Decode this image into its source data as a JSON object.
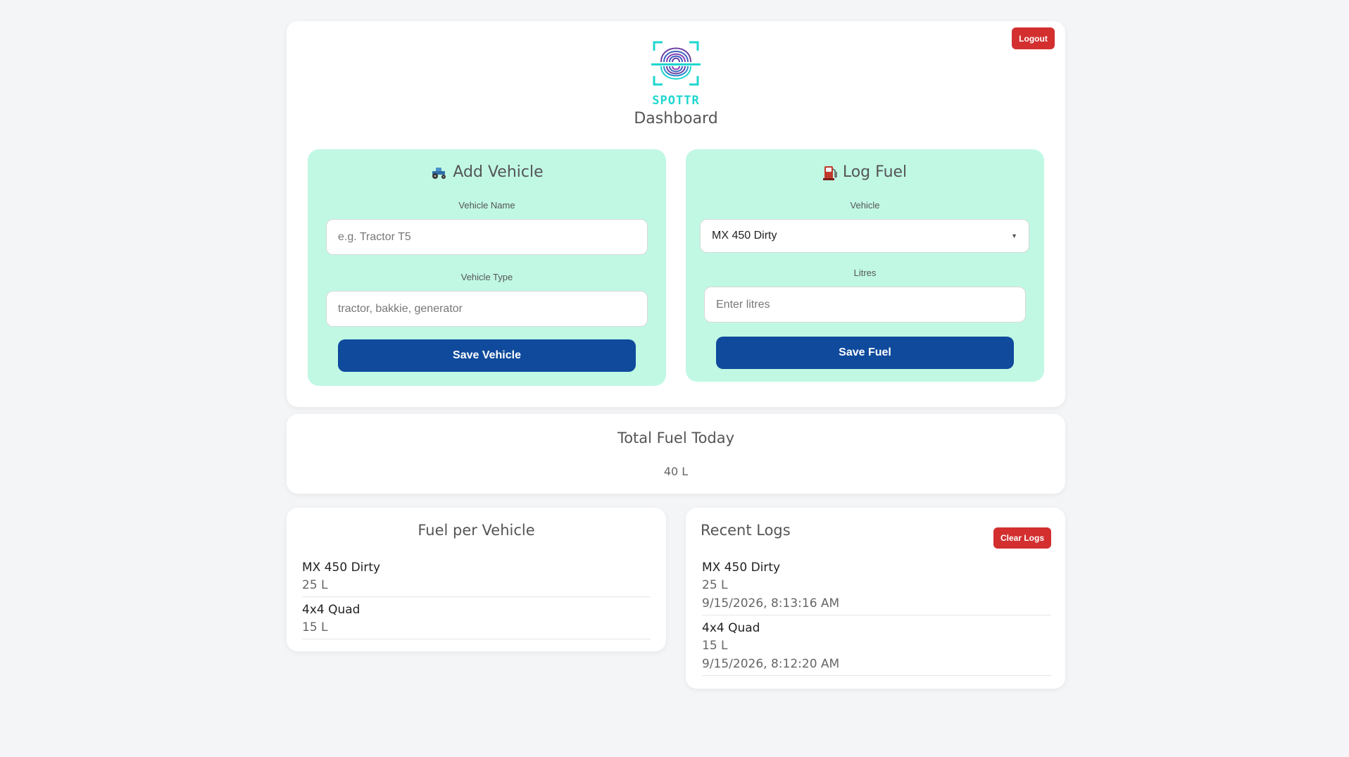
{
  "header": {
    "logo_text": "SPOTTR",
    "title": "Dashboard",
    "logout_label": "Logout"
  },
  "add_vehicle": {
    "title": "Add Vehicle",
    "icon": "tractor-icon",
    "name_label": "Vehicle Name",
    "name_placeholder": "e.g. Tractor T5",
    "name_value": "",
    "type_label": "Vehicle Type",
    "type_placeholder": "tractor, bakkie, generator",
    "type_value": "",
    "save_label": "Save Vehicle"
  },
  "log_fuel": {
    "title": "Log Fuel",
    "icon": "fuel-pump-icon",
    "vehicle_label": "Vehicle",
    "vehicle_selected": "MX 450 Dirty",
    "litres_label": "Litres",
    "litres_placeholder": "Enter litres",
    "litres_value": "",
    "save_label": "Save Fuel"
  },
  "total_today": {
    "title": "Total Fuel Today",
    "value": "40 L"
  },
  "fuel_per_vehicle": {
    "title": "Fuel per Vehicle",
    "items": [
      {
        "name": "MX 450 Dirty",
        "amount": "25 L"
      },
      {
        "name": "4x4 Quad",
        "amount": "15 L"
      }
    ]
  },
  "recent_logs": {
    "title": "Recent Logs",
    "clear_label": "Clear Logs",
    "items": [
      {
        "name": "MX 450 Dirty",
        "amount": "25 L",
        "timestamp": "9/15/2026, 8:13:16 AM"
      },
      {
        "name": "4x4 Quad",
        "amount": "15 L",
        "timestamp": "9/15/2026, 8:12:20 AM"
      }
    ]
  },
  "colors": {
    "background": "#f4f5f7",
    "panel": "#c0f8e4",
    "primary_button": "#0f4a9c",
    "danger_button": "#d32f2f",
    "logo_teal": "#1fd6cf"
  }
}
